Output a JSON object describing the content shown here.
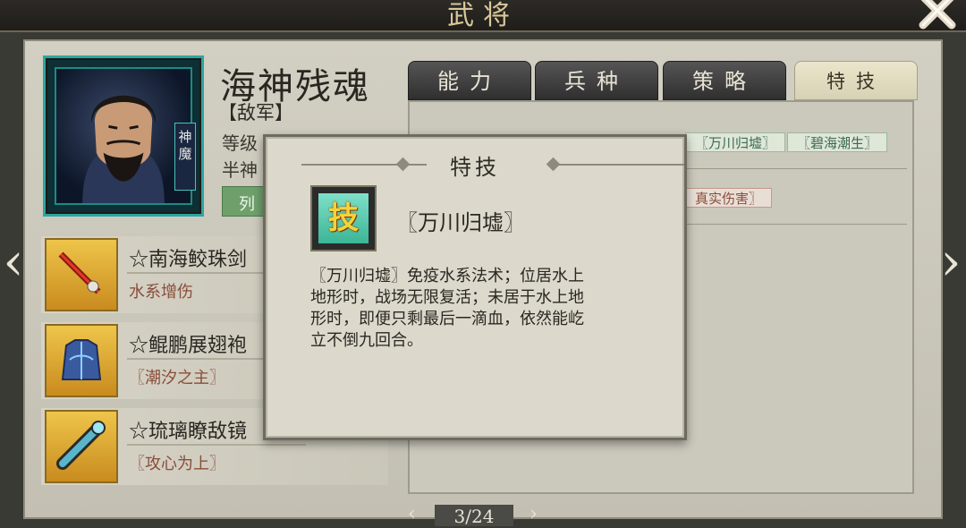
{
  "header": {
    "title": "武将"
  },
  "general": {
    "name": "海神残魂",
    "faction": "【敌军】",
    "type_tag": "神魔",
    "stat_1_label": "等级",
    "stat_2_label": "半神",
    "tag_button": "列"
  },
  "tabs": [
    {
      "label": "能力",
      "active": false
    },
    {
      "label": "兵种",
      "active": false
    },
    {
      "label": "策略",
      "active": false
    },
    {
      "label": "特技",
      "active": true
    }
  ],
  "skills_visible": [
    {
      "label": "〖万川归墟〗",
      "style": "green"
    },
    {
      "label": "〖碧海潮生〗",
      "style": "green"
    },
    {
      "label": "真实伤害〗",
      "style": "red"
    }
  ],
  "equipment": [
    {
      "name": "☆南海鲛珠剑",
      "effect": "水系增伤",
      "icon": "sword-icon"
    },
    {
      "name": "☆鲲鹏展翅袍",
      "effect": "〖潮汐之主〗",
      "icon": "robe-icon"
    },
    {
      "name": "☆琉璃瞭敌镜",
      "effect": "〖攻心为上〗",
      "icon": "spyglass-icon"
    }
  ],
  "popup": {
    "title": "特技",
    "icon_char": "技",
    "skill_name": "〖万川归墟〗",
    "desc_lines": [
      "〖万川归墟〗免疫水系法术；位居水上",
      "地形时，战场无限复活；未居于水上地",
      "形时，即便只剩最后一滴血，依然能屹",
      "立不倒九回合。"
    ]
  },
  "pager": {
    "text": "3/24"
  },
  "nav": {
    "prev": "‹",
    "next": "›"
  }
}
